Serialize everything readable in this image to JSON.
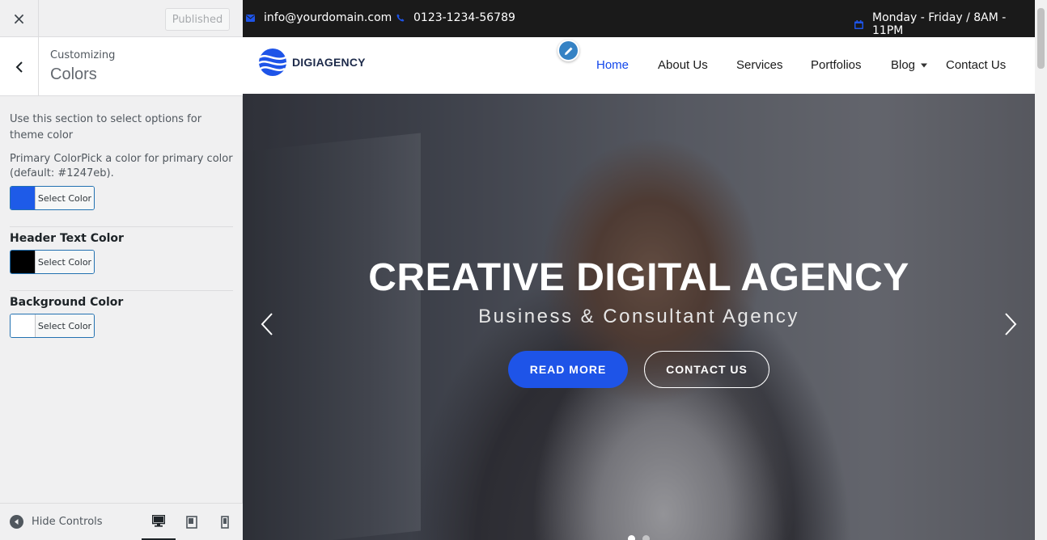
{
  "customizer": {
    "close_icon": "×",
    "published_label": "Published",
    "breadcrumb": "Customizing",
    "section_title": "Colors",
    "section_description": "Use this section to select options for theme color",
    "primary": {
      "description": "Primary ColorPick a color for primary color (default: #1247eb).",
      "button_label": "Select Color",
      "color": "#1e5be8"
    },
    "header_text": {
      "title": "Header Text Color",
      "button_label": "Select Color",
      "color": "#000000"
    },
    "background": {
      "title": "Background Color",
      "button_label": "Select Color",
      "color": "#ffffff"
    },
    "footer": {
      "hide_controls_label": "Hide Controls",
      "devices": [
        "desktop-icon",
        "tablet-icon",
        "mobile-icon"
      ]
    }
  },
  "site": {
    "topbar": {
      "email": "info@yourdomain.com",
      "phone": "0123-1234-56789",
      "hours": "Monday - Friday / 8AM - 11PM"
    },
    "logo_text": "DIGIAGENCY",
    "nav": {
      "home": "Home",
      "about": "About Us",
      "services": "Services",
      "portfolios": "Portfolios",
      "blog": "Blog",
      "contact": "Contact Us"
    },
    "hero": {
      "title": "CREATIVE DIGITAL AGENCY",
      "subtitle": "Business & Consultant Agency",
      "read_more": "READ MORE",
      "contact_us": "CONTACT US"
    },
    "accent_color": "#1247eb"
  }
}
